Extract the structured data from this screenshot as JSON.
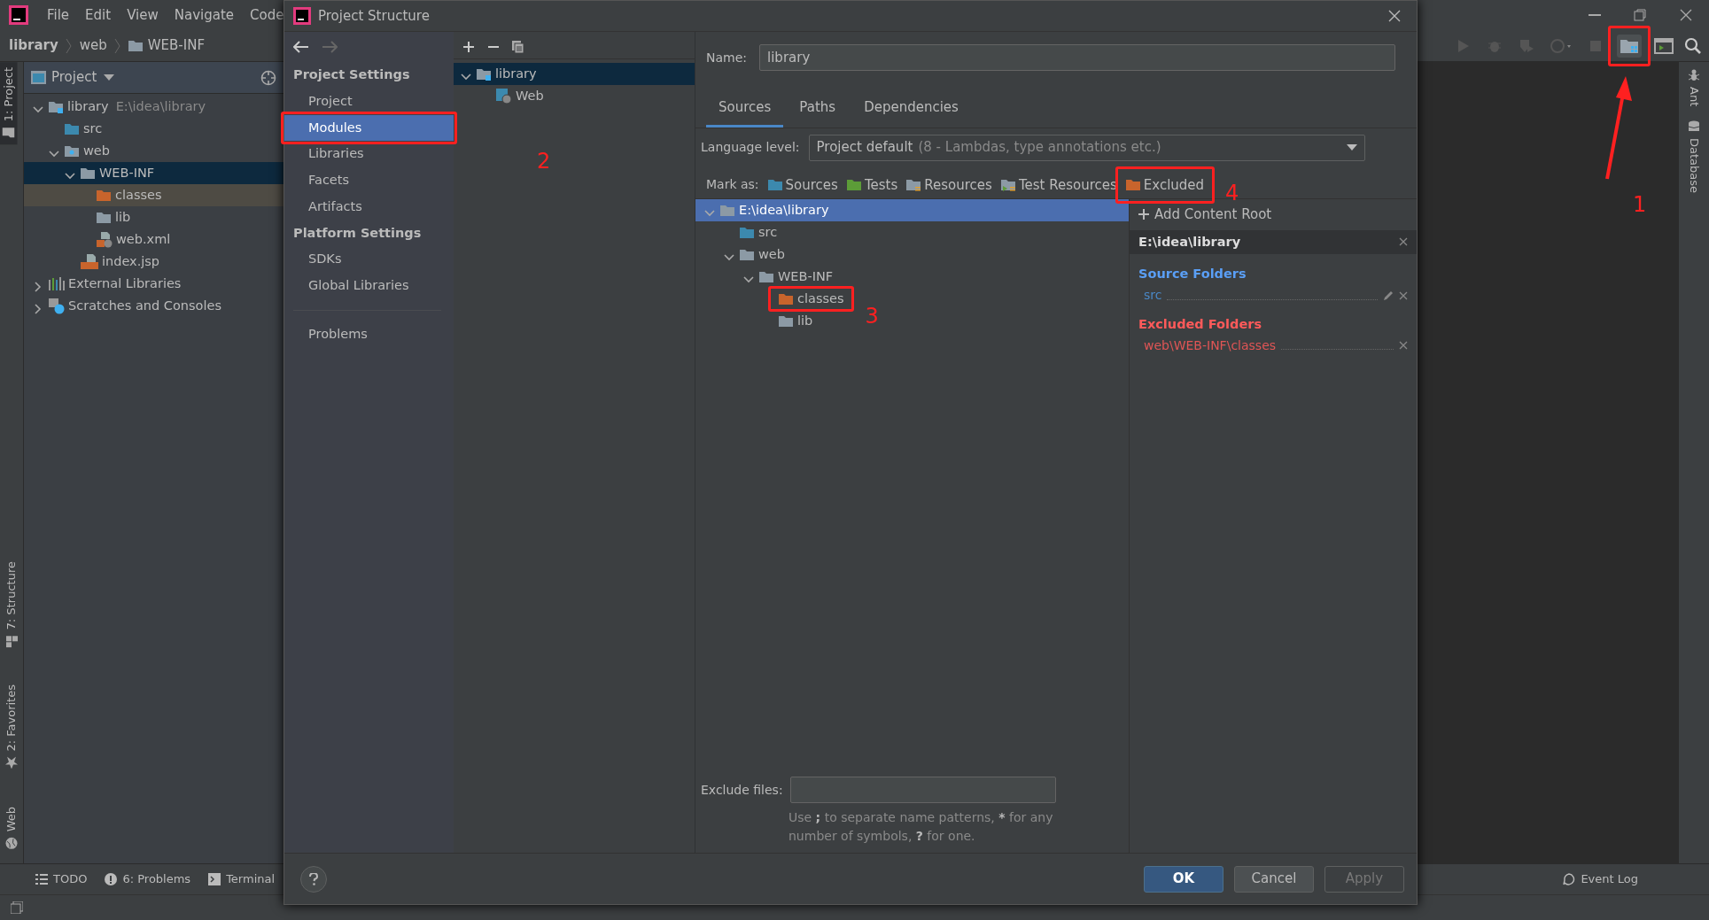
{
  "menu": [
    "File",
    "Edit",
    "View",
    "Navigate",
    "Code"
  ],
  "breadcrumb": [
    {
      "label": "library",
      "kind": "plain"
    },
    {
      "label": "web",
      "kind": "plain"
    },
    {
      "label": "WEB-INF",
      "kind": "folder"
    }
  ],
  "left_strip": {
    "top": [
      {
        "label": "1: Project",
        "kind": "project",
        "selected": true
      }
    ],
    "bottom": [
      {
        "label": "7: Structure",
        "kind": "structure",
        "selected": false
      },
      {
        "label": "2: Favorites",
        "kind": "favorites",
        "selected": false
      },
      {
        "label": "Web",
        "kind": "web",
        "selected": false
      }
    ]
  },
  "project_panel": {
    "title": "Project",
    "tree": [
      {
        "label": "library",
        "detail": "E:\\idea\\library",
        "kind": "module",
        "expanded": true,
        "selected": false,
        "children": [
          {
            "label": "src",
            "kind": "source",
            "selected": false
          },
          {
            "label": "web",
            "kind": "web",
            "expanded": true,
            "selected": false,
            "children": [
              {
                "label": "WEB-INF",
                "kind": "folder",
                "expanded": true,
                "selected": true,
                "children": [
                  {
                    "label": "classes",
                    "kind": "excluded",
                    "selected": false
                  },
                  {
                    "label": "lib",
                    "kind": "folder",
                    "selected": false
                  },
                  {
                    "label": "web.xml",
                    "kind": "xml",
                    "selected": false
                  }
                ]
              },
              {
                "label": "index.jsp",
                "kind": "jsp",
                "selected": false
              }
            ]
          }
        ]
      },
      {
        "label": "External Libraries",
        "kind": "libraries",
        "expanded": false,
        "selected": false
      },
      {
        "label": "Scratches and Consoles",
        "kind": "scratches",
        "expanded": false,
        "selected": false
      }
    ]
  },
  "right_strip": [
    {
      "label": "Ant",
      "kind": "ant"
    },
    {
      "label": "Database",
      "kind": "database"
    }
  ],
  "bottom_tools": [
    {
      "label": "TODO",
      "kind": "todo"
    },
    {
      "label": "6: Problems",
      "kind": "problems"
    },
    {
      "label": "Terminal",
      "kind": "terminal"
    }
  ],
  "event_log": "Event Log",
  "dialog": {
    "title": "Project Structure",
    "sidebar": [
      {
        "kind": "header",
        "label": "Project Settings"
      },
      {
        "kind": "item",
        "label": "Project",
        "selected": false
      },
      {
        "kind": "item",
        "label": "Modules",
        "selected": true
      },
      {
        "kind": "item",
        "label": "Libraries",
        "selected": false
      },
      {
        "kind": "item",
        "label": "Facets",
        "selected": false
      },
      {
        "kind": "item",
        "label": "Artifacts",
        "selected": false
      },
      {
        "kind": "header",
        "label": "Platform Settings"
      },
      {
        "kind": "item",
        "label": "SDKs",
        "selected": false
      },
      {
        "kind": "item",
        "label": "Global Libraries",
        "selected": false
      },
      {
        "kind": "divider"
      },
      {
        "kind": "item",
        "label": "Problems",
        "selected": false
      }
    ],
    "modules": [
      {
        "label": "library",
        "kind": "module",
        "expanded": true,
        "selected": true,
        "children": [
          {
            "label": "Web",
            "kind": "webfacet",
            "selected": false
          }
        ]
      }
    ],
    "name_label": "Name:",
    "name_value": "library",
    "tabs": [
      {
        "label": "Sources",
        "selected": true
      },
      {
        "label": "Paths",
        "selected": false
      },
      {
        "label": "Dependencies",
        "selected": false
      }
    ],
    "language_label": "Language level:",
    "language_value": "Project default",
    "language_detail": "(8 - Lambdas, type annotations etc.)",
    "mark_label": "Mark as:",
    "mark_buttons": [
      {
        "label": "Sources",
        "kind": "source"
      },
      {
        "label": "Tests",
        "kind": "tests"
      },
      {
        "label": "Resources",
        "kind": "resources"
      },
      {
        "label": "Test Resources",
        "kind": "testres"
      },
      {
        "label": "Excluded",
        "kind": "excluded"
      }
    ],
    "tree": [
      {
        "label": "E:\\idea\\library",
        "kind": "folder",
        "expanded": true,
        "selected": true,
        "children": [
          {
            "label": "src",
            "kind": "source",
            "selected": false
          },
          {
            "label": "web",
            "kind": "folder",
            "expanded": true,
            "selected": false,
            "children": [
              {
                "label": "WEB-INF",
                "kind": "folder",
                "expanded": true,
                "selected": false,
                "children": [
                  {
                    "label": "classes",
                    "kind": "excluded",
                    "selected": false
                  },
                  {
                    "label": "lib",
                    "kind": "folder",
                    "selected": false
                  }
                ]
              }
            ]
          }
        ]
      }
    ],
    "add_root": "Add Content Root",
    "root_path": "E:\\idea\\library",
    "groups": [
      {
        "title": "Source Folders",
        "kind": "source",
        "items": [
          "src"
        ]
      },
      {
        "title": "Excluded Folders",
        "kind": "excluded",
        "items": [
          "web\\WEB-INF\\classes"
        ]
      }
    ],
    "exclude_label": "Exclude files:",
    "hint": [
      {
        "text": "Use ",
        "bold": false
      },
      {
        "text": ";",
        "bold": true
      },
      {
        "text": " to separate name patterns, ",
        "bold": false
      },
      {
        "text": "*",
        "bold": true
      },
      {
        "text": " for any number of symbols, ",
        "bold": false
      },
      {
        "text": "?",
        "bold": true
      },
      {
        "text": " for one.",
        "bold": false
      }
    ],
    "buttons": [
      {
        "label": "OK",
        "kind": "primary",
        "disabled": false
      },
      {
        "label": "Cancel",
        "kind": "normal",
        "disabled": false
      },
      {
        "label": "Apply",
        "kind": "normal",
        "disabled": true
      }
    ]
  },
  "annotations": [
    {
      "number": "1"
    },
    {
      "number": "2"
    },
    {
      "number": "3"
    },
    {
      "number": "4"
    }
  ]
}
